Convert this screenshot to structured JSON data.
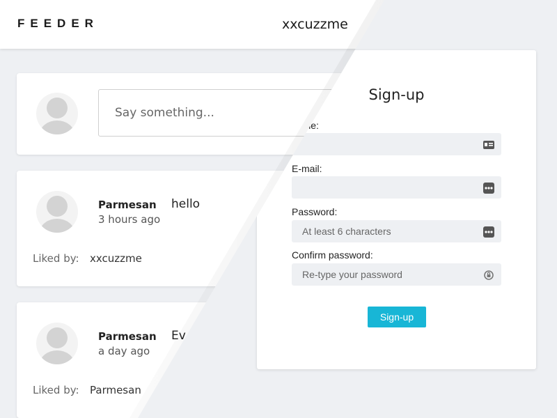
{
  "header": {
    "logo": "FEEDER",
    "username": "xxcuzzme"
  },
  "composer": {
    "placeholder": "Say something..."
  },
  "posts": [
    {
      "author": "Parmesan",
      "time": "3 hours ago",
      "text": "hello",
      "liked_label": "Liked by:",
      "liked_by": "xxcuzzme"
    },
    {
      "author": "Parmesan",
      "time": "a day ago",
      "text": "Ev",
      "liked_label": "Liked by:",
      "liked_by": "Parmesan"
    }
  ],
  "signup": {
    "title": "Sign-up",
    "fields": [
      {
        "label": "name:",
        "placeholder": "",
        "icon": "id-card-icon"
      },
      {
        "label": "E-mail:",
        "placeholder": "",
        "icon": "dots-icon"
      },
      {
        "label": "Password:",
        "placeholder": "At least 6 characters",
        "icon": "dots-icon"
      },
      {
        "label": "Confirm password:",
        "placeholder": "Re-type your password",
        "icon": "refresh-lock-icon"
      }
    ],
    "button": "Sign-up"
  },
  "colors": {
    "accent": "#18b6d6",
    "background": "#eef0f3",
    "field_bg": "#eef0f3"
  }
}
